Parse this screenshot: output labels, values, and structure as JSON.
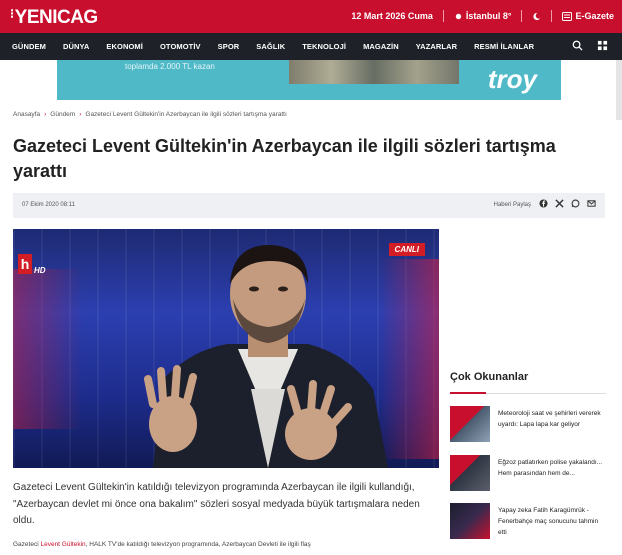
{
  "header": {
    "logo": "YENICAG",
    "date": "12 Mart 2026 Cuma",
    "weather": "İstanbul 8°",
    "egazete": "E-Gazete"
  },
  "nav": {
    "items": [
      "GÜNDEM",
      "DÜNYA",
      "EKONOMİ",
      "OTOMOTİV",
      "SPOR",
      "SAĞLIK",
      "TEKNOLOJİ",
      "MAGAZİN",
      "YAZARLAR",
      "RESMİ İLANLAR"
    ]
  },
  "banner": {
    "text": "toplamda 2.000 TL kazan",
    "brand": "troy"
  },
  "breadcrumb": {
    "items": [
      "Anasayfa",
      "Gündem",
      "Gazeteci Levent Gültekin'in Azerbaycan ile ilgili sözleri tartışma yarattı"
    ]
  },
  "article": {
    "title": "Gazeteci Levent Gültekin'in Azerbaycan ile ilgili sözleri tartışma yarattı",
    "date": "07 Ekim 2020 08:11",
    "share_label": "Haberi Paylaş",
    "video_badge": "CANLI",
    "channel_logo": "h",
    "channel_hd": "HD",
    "lead": "Gazeteci Levent Gültekin'in katıldığı televizyon programında Azerbaycan ile ilgili kullandığı, \"Azerbaycan devlet mi önce ona bakalım\" sözleri sosyal medyada büyük tartışmalara neden oldu.",
    "body_start": "Gazeteci",
    "body_link": "Levent Gültekin",
    "body_rest": ", HALK TV'de katıldığı televizyon programında, Azerbaycan Devleti ile ilgili flaş"
  },
  "sidebar": {
    "title": "Çok Okunanlar",
    "items": [
      {
        "text": "Meteoroloji saat ve şehirleri vererek uyardı: Lapa lapa kar geliyor"
      },
      {
        "text": "Eğzoz patlatırken polise yakalandı... Hem parasından hem de..."
      },
      {
        "text": "Yapay zeka Fatih Karagümrük - Fenerbahçe maç sonucunu tahmin etti"
      }
    ]
  },
  "colors": {
    "brand_red": "#c8102e",
    "nav_dark": "#1e2228"
  }
}
